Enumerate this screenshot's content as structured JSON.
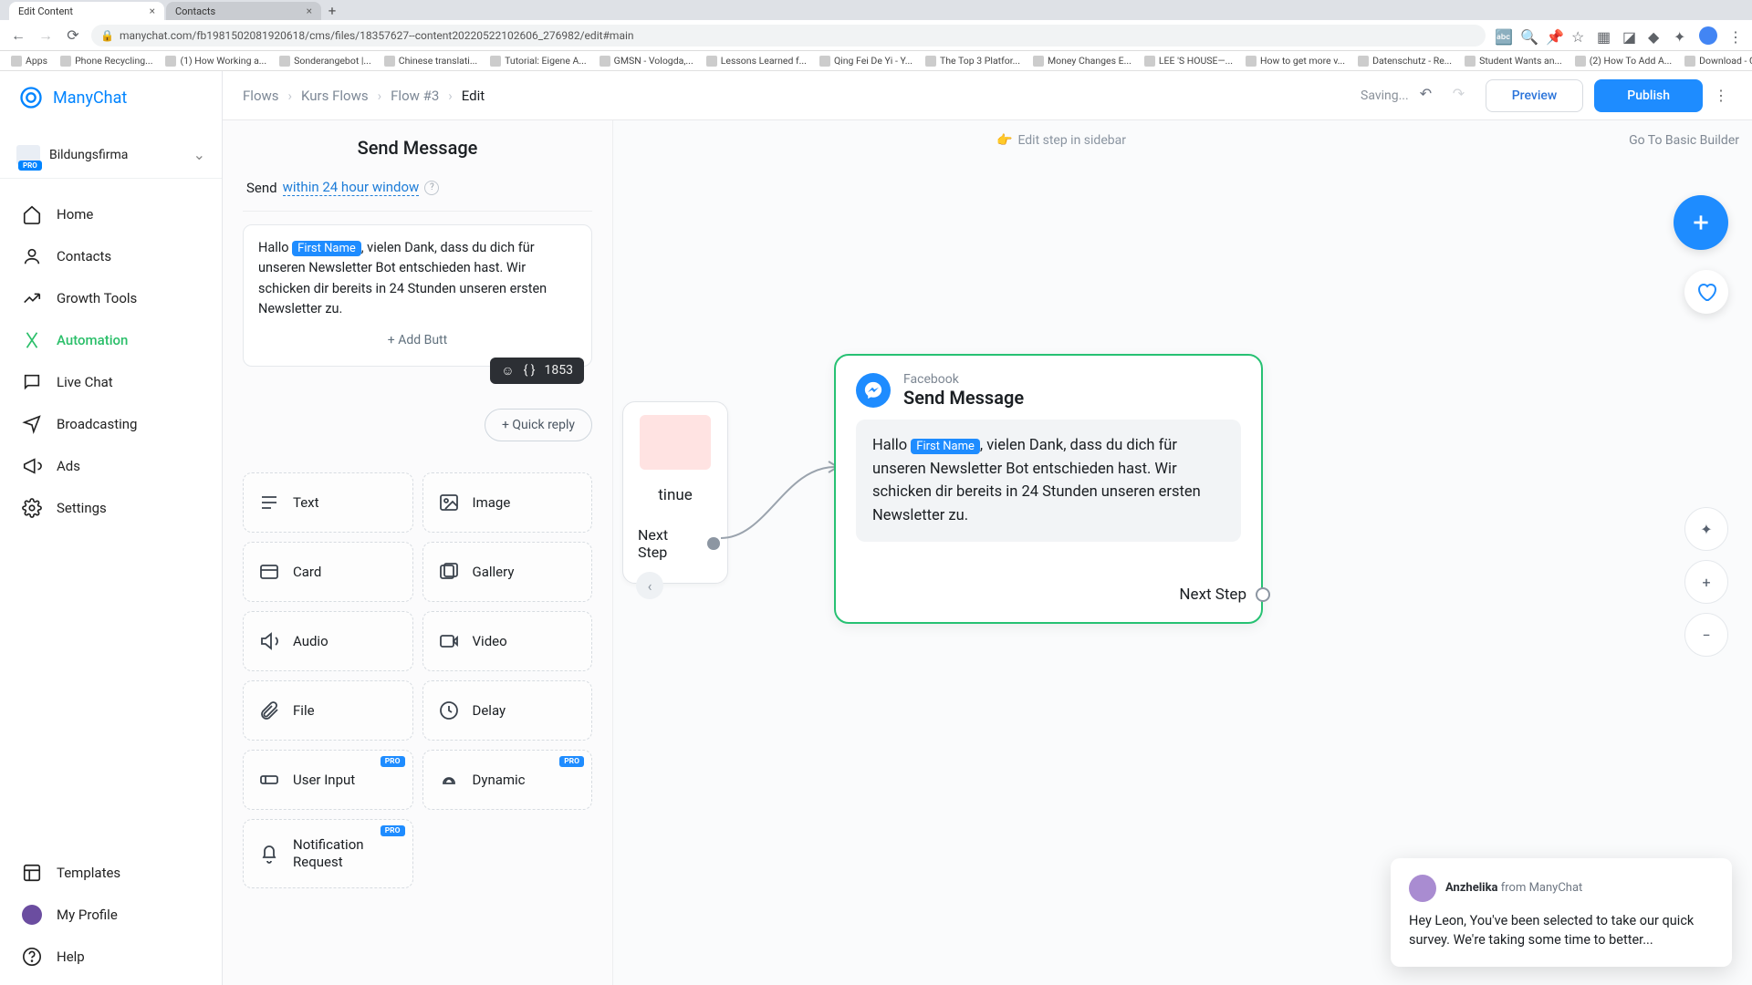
{
  "browser": {
    "tabs": [
      {
        "title": "Edit Content"
      },
      {
        "title": "Contacts"
      }
    ],
    "url": "manychat.com/fb1981502081920618/cms/files/18357627--content20220522102606_276982/edit#main",
    "bookmarks": [
      "Apps",
      "Phone Recycling...",
      "(1) How Working a...",
      "Sonderangebot |...",
      "Chinese translati...",
      "Tutorial: Eigene A...",
      "GMSN - Vologda,...",
      "Lessons Learned f...",
      "Qing Fei De Yi - Y...",
      "The Top 3 Platfor...",
      "Money Changes E...",
      "LEE 'S HOUSE—...",
      "How to get more v...",
      "Datenschutz - Re...",
      "Student Wants an...",
      "(2) How To Add A...",
      "Download - Cooki..."
    ]
  },
  "app": {
    "brand": "ManyChat",
    "workspace": {
      "name": "Bildungsfirma",
      "badge": "PRO"
    },
    "nav": {
      "home": "Home",
      "contacts": "Contacts",
      "growth": "Growth Tools",
      "automation": "Automation",
      "livechat": "Live Chat",
      "broadcasting": "Broadcasting",
      "ads": "Ads",
      "settings": "Settings",
      "templates": "Templates",
      "profile": "My Profile",
      "help": "Help"
    },
    "breadcrumbs": [
      "Flows",
      "Kurs Flows",
      "Flow #3",
      "Edit"
    ],
    "saving": "Saving...",
    "preview": "Preview",
    "publish": "Publish",
    "editInSidebar": "Edit step in sidebar",
    "gotoBasic": "Go To Basic Builder"
  },
  "editor": {
    "title": "Send Message",
    "send_label": "Send",
    "send_window": "within 24 hour window",
    "message_pre": "Hallo ",
    "variable": "First Name",
    "message_post": ", vielen Dank, dass du dich für unseren Newsletter Bot entschieden hast. Wir schicken dir bereits in 24 Stunden unseren ersten Newsletter zu.",
    "char_count": "1853",
    "add_button": "+ Add Butt",
    "quick_reply": "+ Quick reply",
    "blocks": {
      "text": "Text",
      "image": "Image",
      "card": "Card",
      "gallery": "Gallery",
      "audio": "Audio",
      "video": "Video",
      "file": "File",
      "delay": "Delay",
      "userinput": "User Input",
      "dynamic": "Dynamic",
      "notif": "Notification Request",
      "pro": "PRO"
    }
  },
  "canvas": {
    "prev_tinue": "tinue",
    "prev_next": "Next Step",
    "node_platform": "Facebook",
    "node_action": "Send Message",
    "node_next": "Next Step"
  },
  "chat": {
    "name": "Anzhelika",
    "from": " from ManyChat",
    "body": "Hey Leon,  You've been selected to take our quick survey. We're taking some time to better..."
  }
}
